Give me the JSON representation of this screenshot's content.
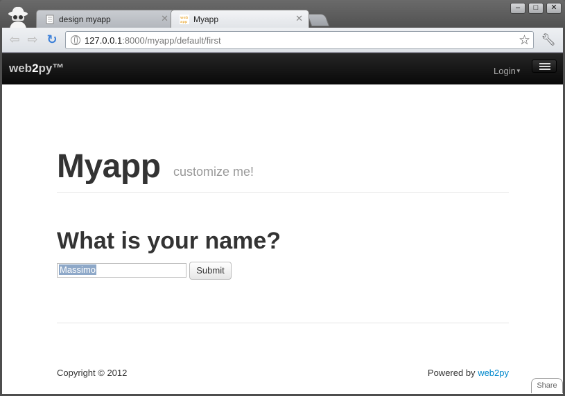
{
  "browser": {
    "tabs": [
      {
        "title": "design myapp",
        "active": false
      },
      {
        "title": "Myapp",
        "active": true
      }
    ],
    "url_host": "127.0.0.1",
    "url_rest": ":8000/myapp/default/first",
    "window_controls": {
      "minimize": "–",
      "maximize": "□",
      "close": "✕"
    }
  },
  "navbar": {
    "brand_prefix": "web",
    "brand_bold": "2",
    "brand_suffix": "py™",
    "login_label": "Login"
  },
  "header": {
    "title": "Myapp",
    "subtitle": "customize me!"
  },
  "form": {
    "question": "What is your name?",
    "name_value": "Massimo",
    "submit_label": "Submit"
  },
  "footer": {
    "copyright": "Copyright © 2012",
    "powered_prefix": "Powered by",
    "powered_link": "web2py"
  },
  "share_label": "Share",
  "colors": {
    "navbar_bg": "#1b1b1b",
    "link": "#0088cc",
    "selection": "#8ea8c8"
  }
}
